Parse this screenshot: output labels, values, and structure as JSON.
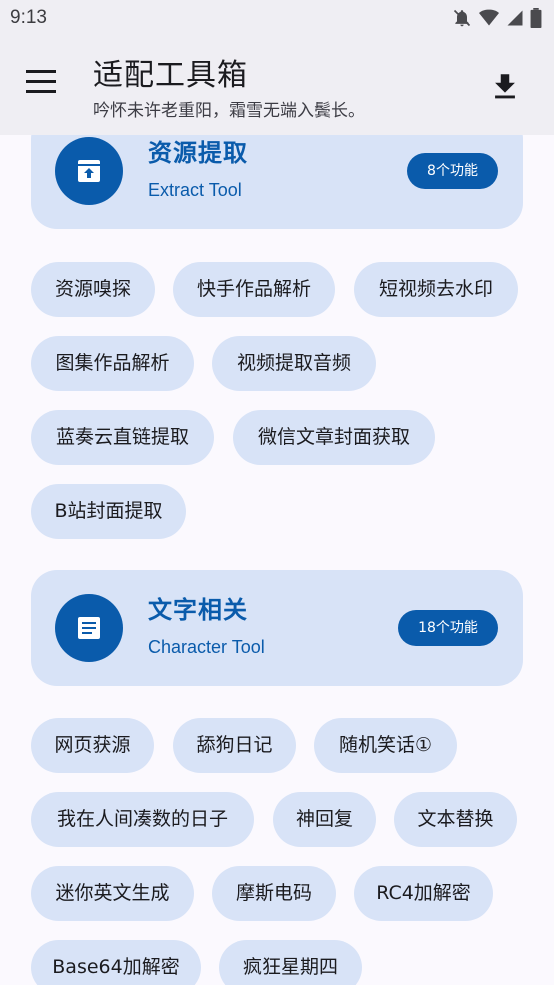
{
  "status_bar": {
    "time": "9:13"
  },
  "app_bar": {
    "title": "适配工具箱",
    "subtitle": "吟怀未许老重阳，霜雪无端入鬓长。"
  },
  "sections": [
    {
      "title": "资源提取",
      "subtitle": "Extract Tool",
      "badge": "8个功能",
      "chips": [
        "资源嗅探",
        "快手作品解析",
        "短视频去水印",
        "图集作品解析",
        "视频提取音频",
        "蓝奏云直链提取",
        "微信文章封面获取",
        "B站封面提取"
      ]
    },
    {
      "title": "文字相关",
      "subtitle": "Character Tool",
      "badge": "18个功能",
      "chips": [
        "网页获源",
        "舔狗日记",
        "随机笑话①",
        "我在人间凑数的日子",
        "神回复",
        "文本替换",
        "迷你英文生成",
        "摩斯电码",
        "RC4加解密",
        "Base64加解密",
        "疯狂星期四"
      ]
    }
  ],
  "colors": {
    "accent": "#0a5bab",
    "chip_bg": "#d8e3f7",
    "bar_bg": "#efeef3"
  },
  "icons": {
    "menu": "menu-icon",
    "download": "download-icon",
    "extract": "unarchive-icon",
    "text": "article-icon"
  }
}
